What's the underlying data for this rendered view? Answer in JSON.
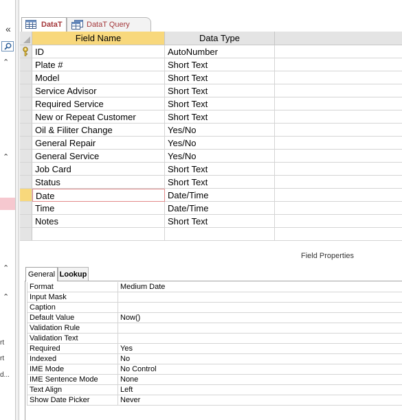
{
  "nav": {
    "collapse_glyph": "«",
    "section_glyph": "⌃",
    "fragments": [
      "rt",
      "rt",
      "d..."
    ]
  },
  "tabs": [
    {
      "label": "DataT",
      "active": true
    },
    {
      "label": "DataT Query",
      "active": false
    }
  ],
  "grid": {
    "headers": {
      "field_name": "Field Name",
      "data_type": "Data Type",
      "description": ""
    },
    "rows": [
      {
        "field": "ID",
        "type": "AutoNumber",
        "key": true
      },
      {
        "field": "Plate #",
        "type": "Short Text"
      },
      {
        "field": "Model",
        "type": "Short Text"
      },
      {
        "field": "Service Advisor",
        "type": "Short Text"
      },
      {
        "field": "Required Service",
        "type": "Short Text"
      },
      {
        "field": "New or Repeat Customer",
        "type": "Short Text"
      },
      {
        "field": "Oil & Filiter Change",
        "type": "Yes/No"
      },
      {
        "field": "General Repair",
        "type": "Yes/No"
      },
      {
        "field": "General Service",
        "type": "Yes/No"
      },
      {
        "field": "Job Card",
        "type": "Short Text"
      },
      {
        "field": "Status",
        "type": "Short Text"
      },
      {
        "field": "Date",
        "type": "Date/Time",
        "current": true
      },
      {
        "field": "Time",
        "type": "Date/Time"
      },
      {
        "field": "Notes",
        "type": "Short Text"
      },
      {
        "field": "",
        "type": ""
      }
    ]
  },
  "field_properties": {
    "title": "Field Properties",
    "tabs": [
      {
        "label": "General",
        "active": true
      },
      {
        "label": "Lookup",
        "active": false
      }
    ],
    "rows": [
      {
        "name": "Format",
        "value": "Medium Date"
      },
      {
        "name": "Input Mask",
        "value": ""
      },
      {
        "name": "Caption",
        "value": ""
      },
      {
        "name": "Default Value",
        "value": "Now()"
      },
      {
        "name": "Validation Rule",
        "value": ""
      },
      {
        "name": "Validation Text",
        "value": ""
      },
      {
        "name": "Required",
        "value": "Yes"
      },
      {
        "name": "Indexed",
        "value": "No"
      },
      {
        "name": "IME Mode",
        "value": "No Control"
      },
      {
        "name": "IME Sentence Mode",
        "value": "None"
      },
      {
        "name": "Text Align",
        "value": "Left"
      },
      {
        "name": "Show Date Picker",
        "value": "Never"
      }
    ]
  },
  "colors": {
    "accent": "#a4373a",
    "header_yellow": "#f8d87c",
    "selection_pink": "#f6c8cf"
  }
}
